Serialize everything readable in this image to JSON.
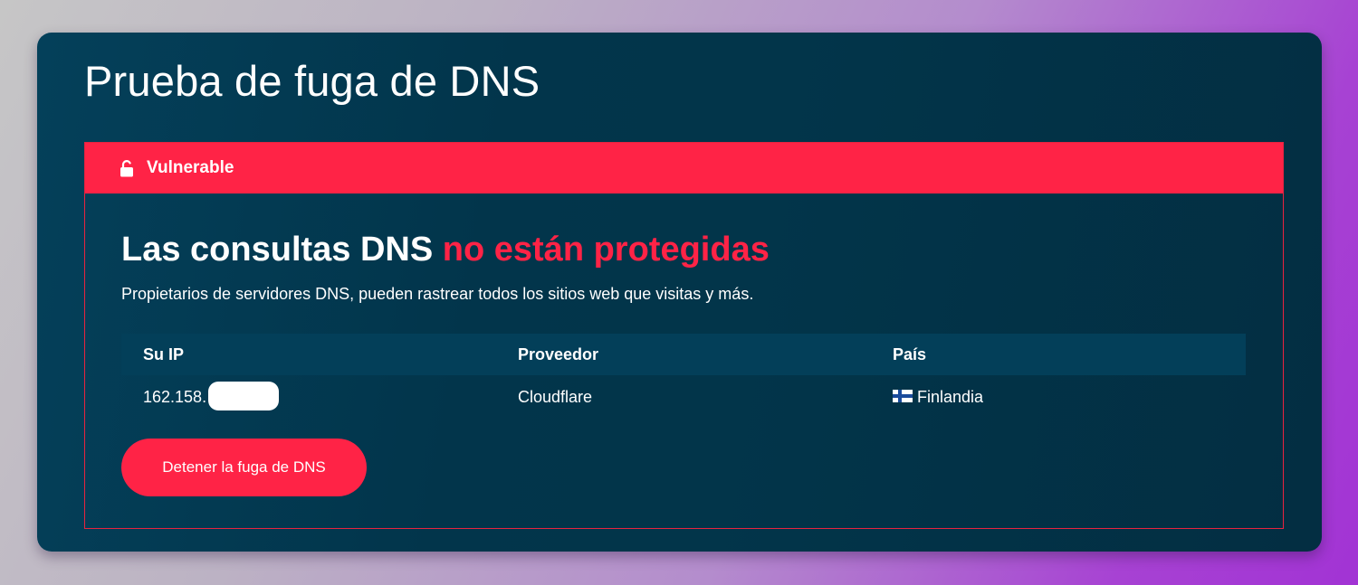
{
  "page": {
    "title": "Prueba de fuga de DNS"
  },
  "status": {
    "icon": "unlocked-padlock-icon",
    "label": "Vulnerable",
    "color": "#ff2346"
  },
  "headline": {
    "prefix": "Las consultas DNS",
    "accent": "no están protegidas"
  },
  "description": "Propietarios de servidores DNS, pueden rastrear todos los sitios web que visitas y más.",
  "table": {
    "headers": {
      "ip": "Su IP",
      "provider": "Proveedor",
      "country": "País"
    },
    "row": {
      "ip_visible": "162.158.",
      "provider": "Cloudflare",
      "country_flag_icon": "finland-flag-icon",
      "country": "Finlandia"
    }
  },
  "actions": {
    "stop_label": "Detener la fuga de DNS"
  },
  "colors": {
    "card_background": "#02354b",
    "accent": "#ff2346",
    "table_header_background": "#033f59"
  }
}
